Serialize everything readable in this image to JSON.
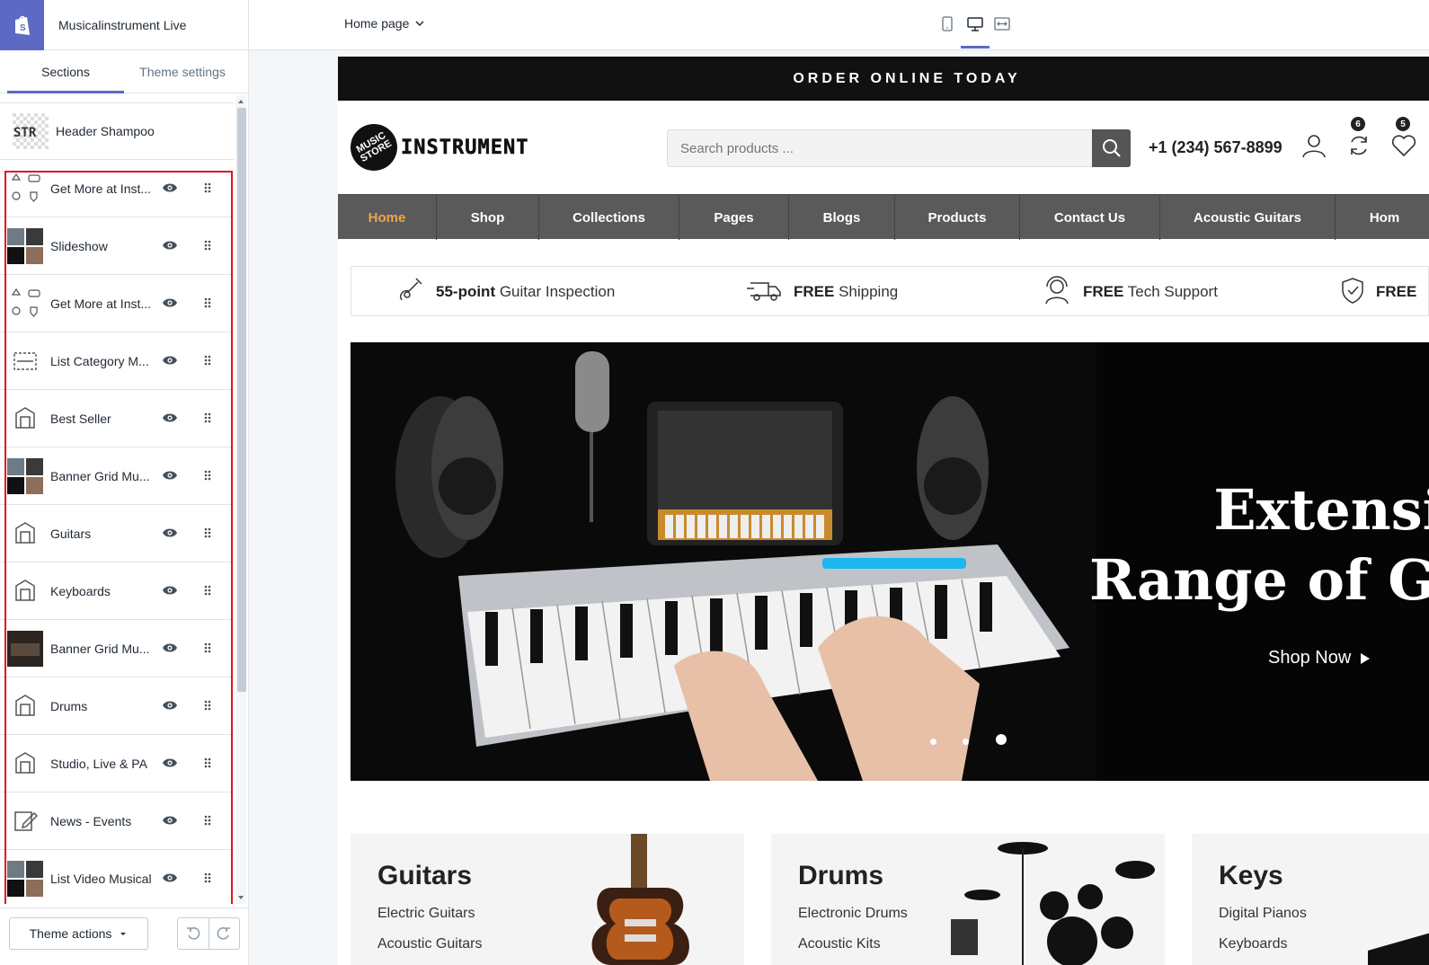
{
  "editor": {
    "store_name": "Musicalinstrument Live",
    "tabs": [
      "Sections",
      "Theme settings"
    ],
    "header_section": "Header Shampoo",
    "sections": [
      {
        "label": "Get More at Inst...",
        "thumb": "multi-icon"
      },
      {
        "label": "Slideshow",
        "thumb": "photo"
      },
      {
        "label": "Get More at Inst...",
        "thumb": "multi-icon"
      },
      {
        "label": "List Category M...",
        "thumb": "list-icon"
      },
      {
        "label": "Best Seller",
        "thumb": "collection-icon"
      },
      {
        "label": "Banner Grid Mu...",
        "thumb": "photo"
      },
      {
        "label": "Guitars",
        "thumb": "collection-icon"
      },
      {
        "label": "Keyboards",
        "thumb": "collection-icon"
      },
      {
        "label": "Banner Grid Mu...",
        "thumb": "photo-dark"
      },
      {
        "label": "Drums",
        "thumb": "collection-icon"
      },
      {
        "label": "Studio, Live & PA",
        "thumb": "collection-icon"
      },
      {
        "label": "News - Events",
        "thumb": "edit-icon"
      },
      {
        "label": "List Video Musical",
        "thumb": "photo"
      }
    ],
    "theme_actions": "Theme actions",
    "page_selector": "Home page"
  },
  "store": {
    "announcement": "ORDER ONLINE TODAY",
    "logo_circle": "MUSIC STORE",
    "logo_text": "INSTRUMENT",
    "search_placeholder": "Search products ...",
    "phone": "+1 (234) 567-8899",
    "compare_count": "6",
    "wishlist_count": "5",
    "nav": [
      "Home",
      "Shop",
      "Collections",
      "Pages",
      "Blogs",
      "Products",
      "Contact Us",
      "Acoustic Guitars",
      "Hom"
    ],
    "features": [
      {
        "bold": "55-point",
        "rest": " Guitar Inspection",
        "icon": "guitar-hand-icon"
      },
      {
        "bold": "FREE",
        "rest": " Shipping",
        "icon": "truck-icon"
      },
      {
        "bold": "FREE",
        "rest": " Tech Support",
        "icon": "support-agent-icon"
      },
      {
        "bold": "FREE",
        "rest": "",
        "icon": "shield-check-icon"
      }
    ],
    "hero": {
      "line1": "Extensiv",
      "line2": "Range of Gu",
      "cta": "Shop Now"
    },
    "categories": [
      {
        "title": "Guitars",
        "items": [
          "Electric Guitars",
          "Acoustic Guitars"
        ]
      },
      {
        "title": "Drums",
        "items": [
          "Electronic Drums",
          "Acoustic Kits"
        ]
      },
      {
        "title": "Keys",
        "items": [
          "Digital Pianos",
          "Keyboards"
        ]
      }
    ]
  },
  "colors": {
    "accent": "#5c6ac4",
    "highlight": "#e3121f",
    "nav_bg": "#5a5a5a",
    "nav_active": "#f0a34a"
  }
}
